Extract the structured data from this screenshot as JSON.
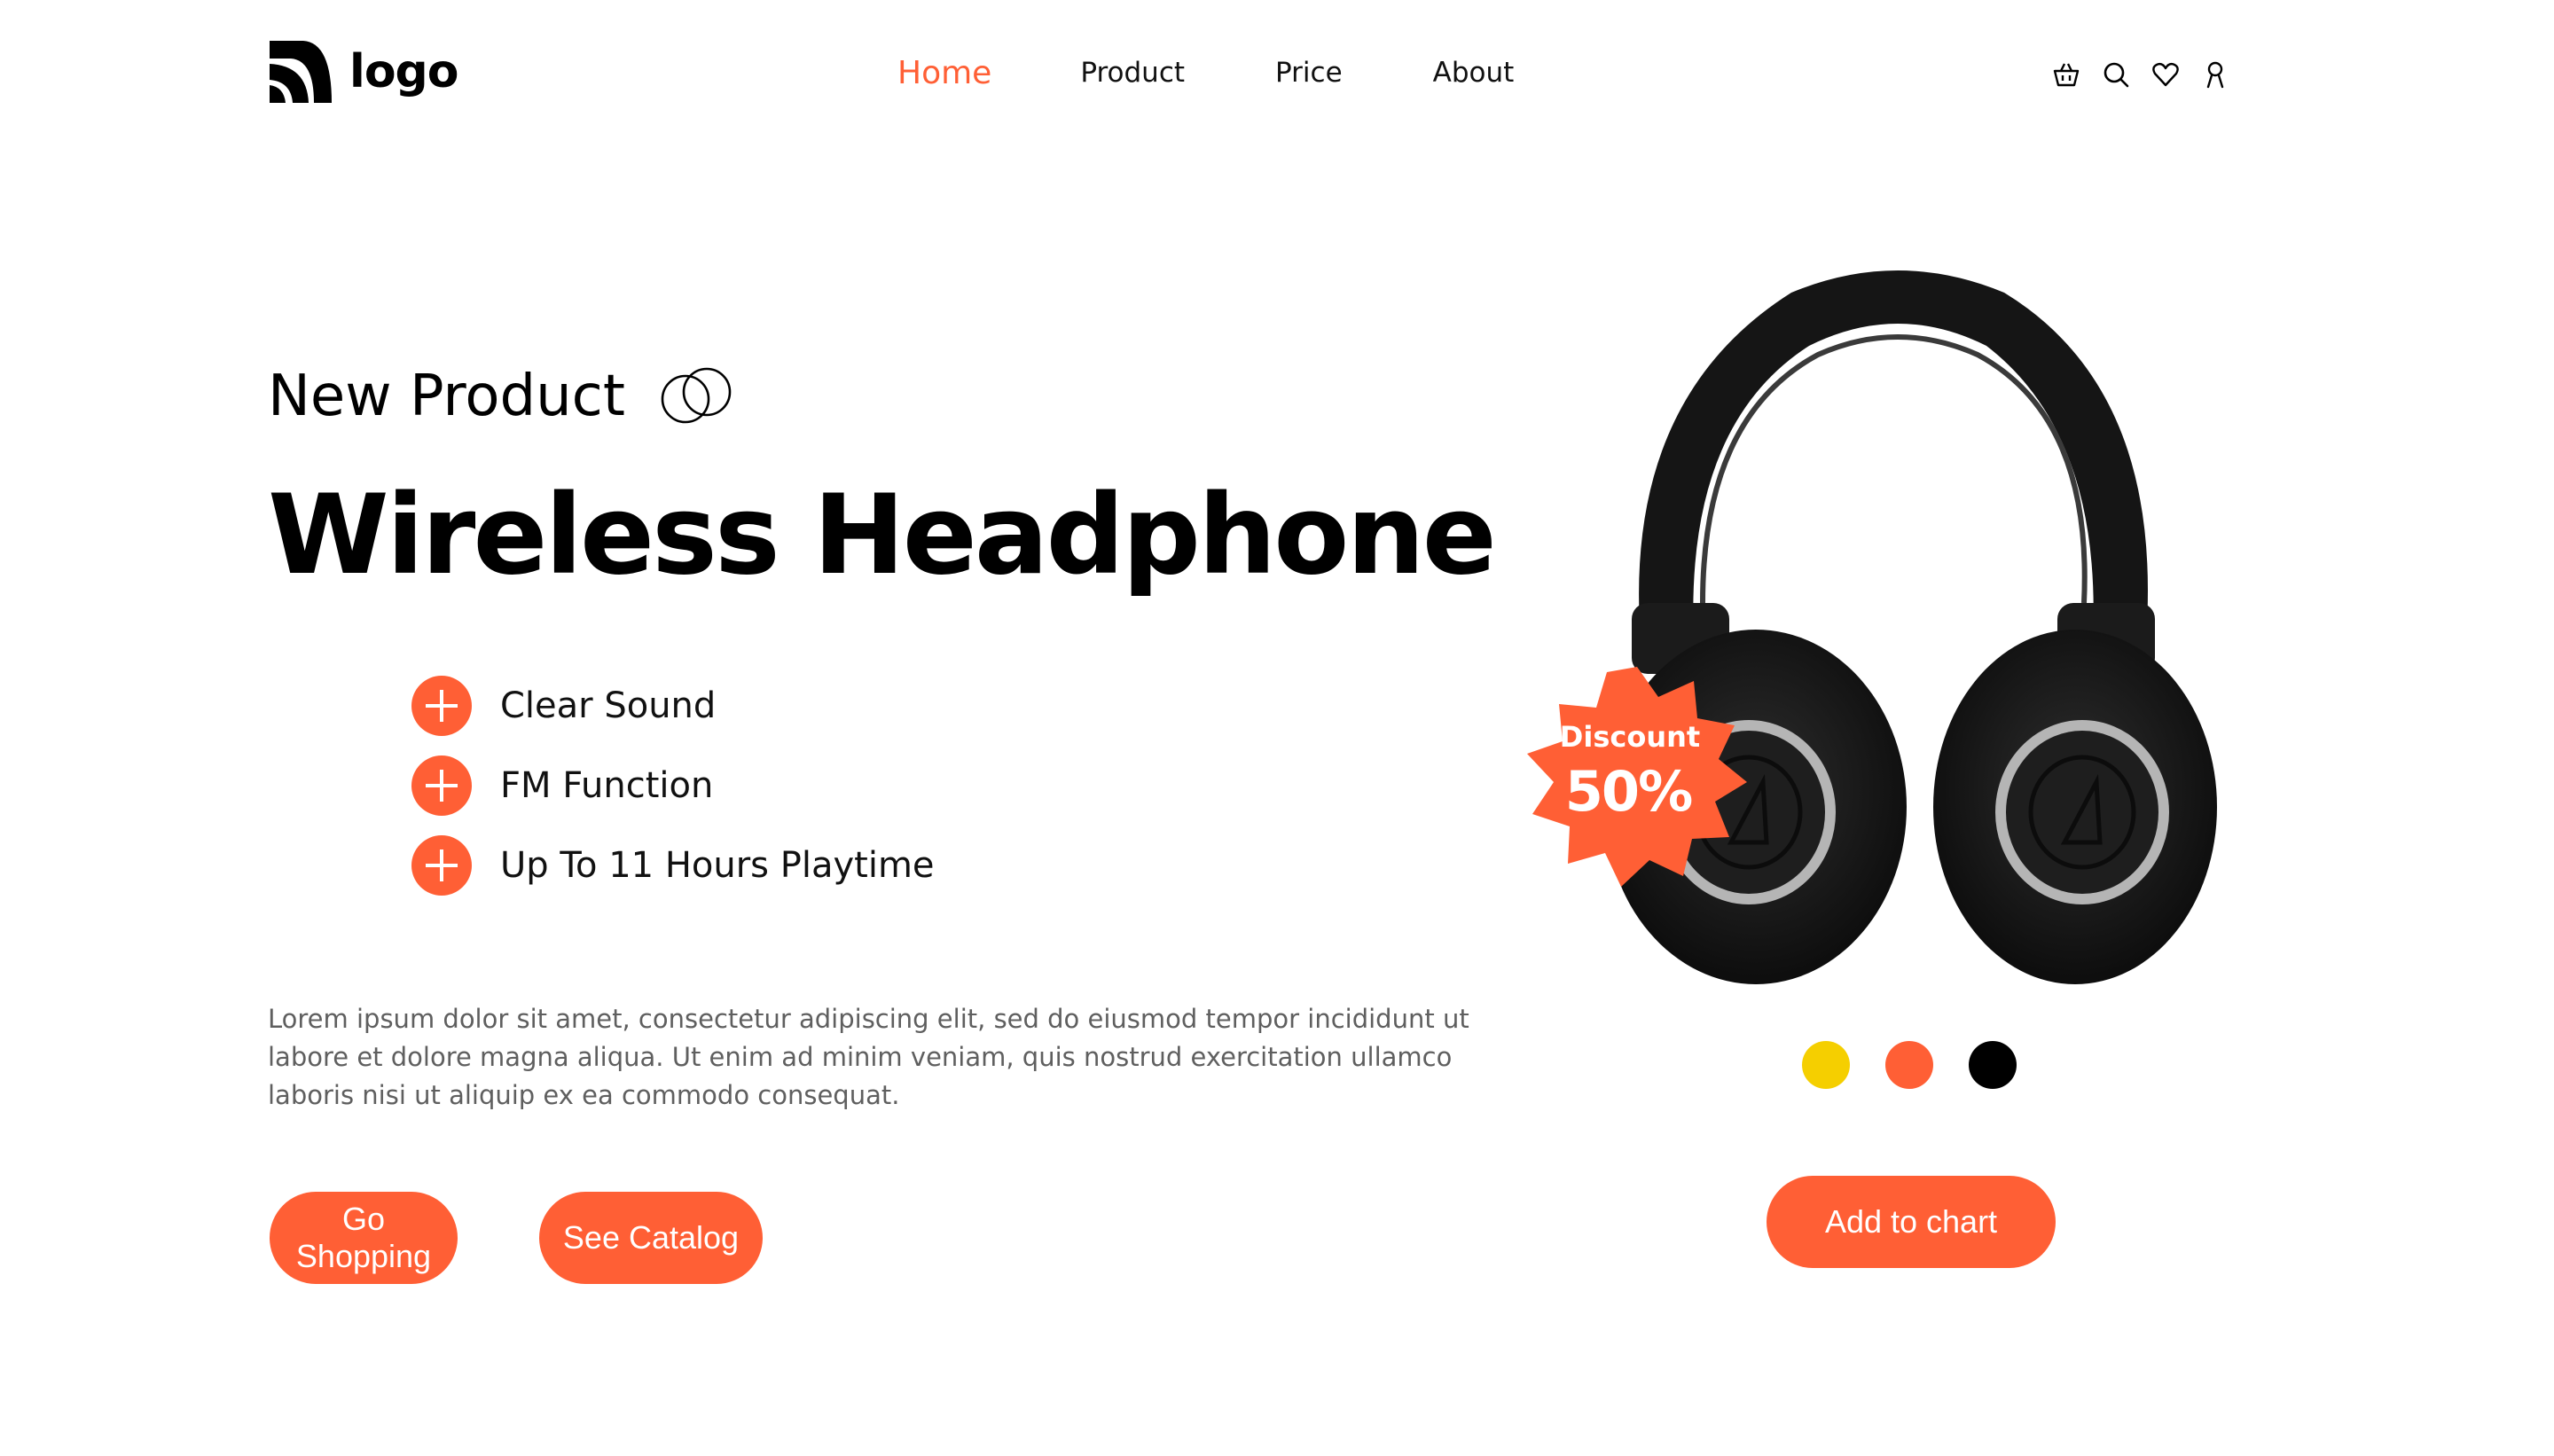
{
  "header": {
    "logo_text": "logo",
    "nav": [
      {
        "label": "Home",
        "active": true
      },
      {
        "label": "Product",
        "active": false
      },
      {
        "label": "Price",
        "active": false
      },
      {
        "label": "About",
        "active": false
      }
    ],
    "icons": [
      "basket-icon",
      "search-icon",
      "heart-icon",
      "user-icon"
    ]
  },
  "hero": {
    "eyebrow": "New Product",
    "headline": "Wireless Headphone",
    "features": [
      "Clear Sound",
      "FM Function",
      "Up To 11 Hours Playtime"
    ],
    "description": "Lorem ipsum dolor sit amet, consectetur adipiscing elit, sed do eiusmod tempor incididunt ut labore et dolore magna aliqua. Ut enim ad minim veniam, quis nostrud exercitation ullamco laboris nisi ut aliquip ex ea commodo consequat.",
    "buttons": {
      "shop": "Go Shopping",
      "catalog": "See Catalog"
    }
  },
  "product": {
    "badge": {
      "title": "Discount",
      "value": "50%"
    },
    "color_options": [
      "#f5cf00",
      "#ff5f35",
      "#000000"
    ],
    "cart_button": "Add to chart"
  },
  "colors": {
    "accent": "#ff5f35",
    "text": "#000000",
    "muted": "#5f5f5f"
  }
}
